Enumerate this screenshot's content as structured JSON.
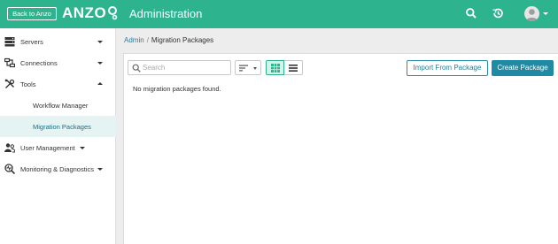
{
  "header": {
    "back_label": "Back to Anzo",
    "logo_text": "ANZO",
    "title": "Administration",
    "icons": [
      "search-icon",
      "history-icon",
      "avatar",
      "chevron-down-icon"
    ],
    "colors": {
      "bar": "#2db38d"
    }
  },
  "sidebar": {
    "items": [
      {
        "label": "Servers",
        "icon": "server-icon",
        "expanded": false
      },
      {
        "label": "Connections",
        "icon": "connections-icon",
        "expanded": false
      },
      {
        "label": "Tools",
        "icon": "tools-icon",
        "expanded": true,
        "children": [
          {
            "label": "Workflow Manager",
            "active": false
          },
          {
            "label": "Migration Packages",
            "active": true
          }
        ]
      },
      {
        "label": "User Management",
        "icon": "users-icon",
        "expanded": false
      },
      {
        "label": "Monitoring & Diagnostics",
        "icon": "monitoring-icon",
        "expanded": false
      }
    ]
  },
  "breadcrumb": {
    "parent": "Admin",
    "separator": "/",
    "current": "Migration Packages"
  },
  "toolbar": {
    "search_placeholder": "Search",
    "view_mode": "grid",
    "import_label": "Import From Package",
    "create_label": "Create Package",
    "colors": {
      "primary": "#1f8aa3",
      "active_view": "#2db38d"
    }
  },
  "main": {
    "empty_message": "No migration packages found."
  }
}
